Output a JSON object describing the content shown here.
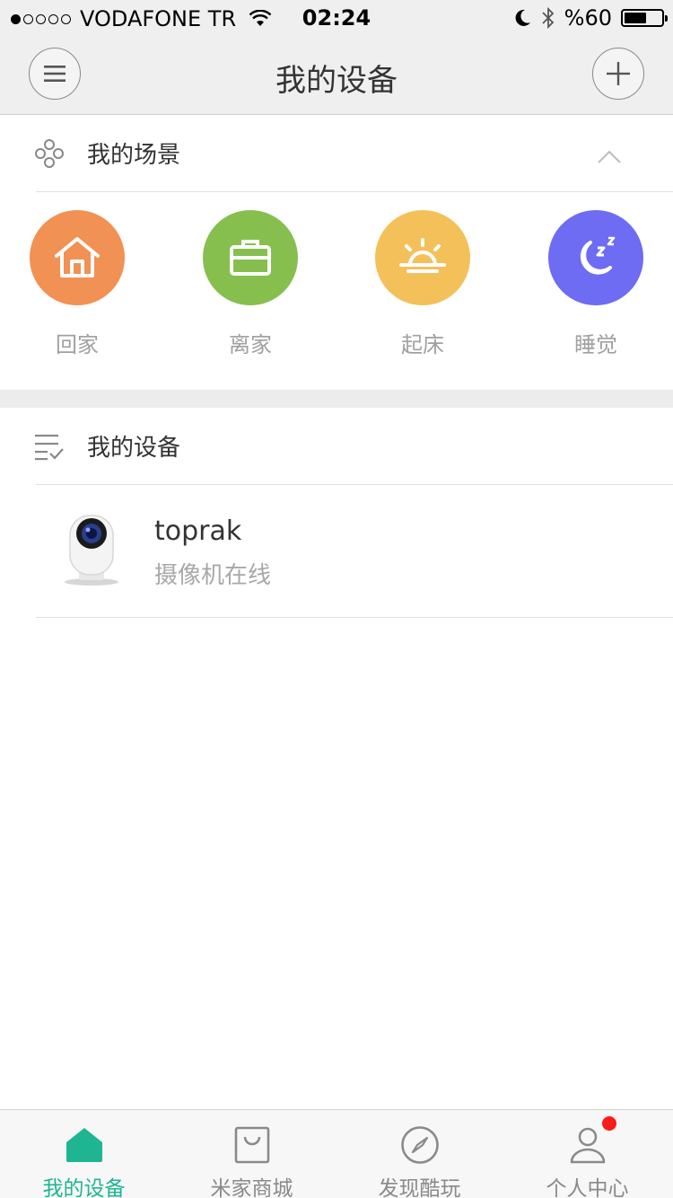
{
  "status_bar": {
    "carrier": "VODAFONE TR",
    "time": "02:24",
    "battery": "%60",
    "battery_level": 0.6,
    "signal_bars_filled": 1,
    "signal_bars_total": 5
  },
  "nav": {
    "title": "我的设备",
    "left_icon": "menu-icon",
    "right_icon": "plus-icon"
  },
  "scenes": {
    "title": "我的场景",
    "expanded": true,
    "items": [
      {
        "label": "回家",
        "icon": "home-icon",
        "color": "#f29154"
      },
      {
        "label": "离家",
        "icon": "briefcase-icon",
        "color": "#86bf4e"
      },
      {
        "label": "起床",
        "icon": "sunrise-icon",
        "color": "#f4c05a"
      },
      {
        "label": "睡觉",
        "icon": "moon-icon",
        "color": "#6d6cf3"
      }
    ]
  },
  "devices": {
    "title": "我的设备",
    "items": [
      {
        "name": "toprak",
        "status": "摄像机在线",
        "icon": "camera-icon"
      }
    ]
  },
  "tabbar": {
    "accent_color": "#1fb592",
    "tabs": [
      {
        "label": "我的设备",
        "icon": "home-tab-icon",
        "active": true
      },
      {
        "label": "米家商城",
        "icon": "shopping-bag-icon",
        "active": false
      },
      {
        "label": "发现酷玩",
        "icon": "compass-icon",
        "active": false
      },
      {
        "label": "个人中心",
        "icon": "person-icon",
        "active": false,
        "has_badge": true
      }
    ]
  }
}
